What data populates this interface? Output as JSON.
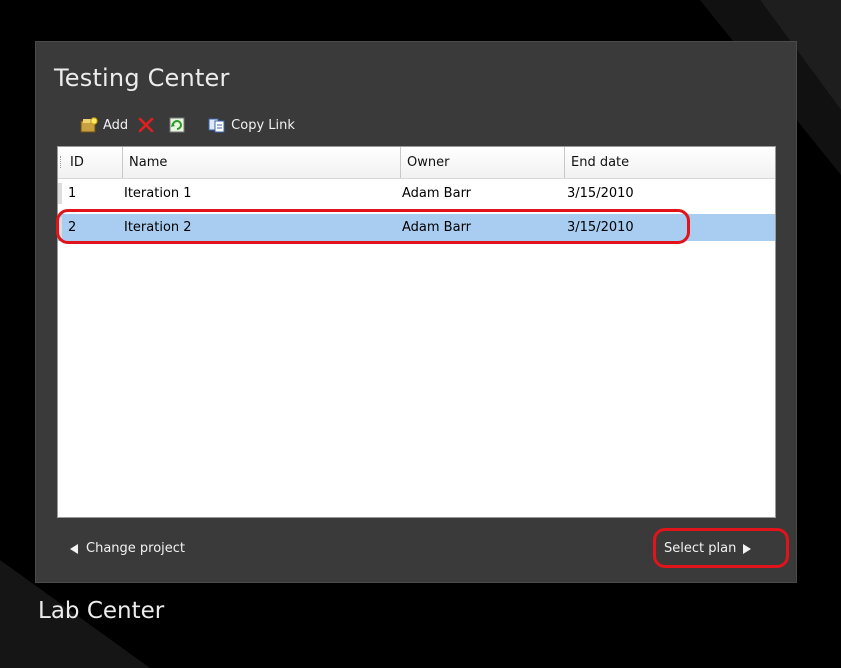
{
  "panel": {
    "title": "Testing Center"
  },
  "toolbar": {
    "add_label": "Add",
    "copy_link_label": "Copy Link"
  },
  "grid": {
    "columns": [
      "ID",
      "Name",
      "Owner",
      "End date"
    ],
    "rows": [
      {
        "id": "1",
        "name": "Iteration 1",
        "owner": "Adam Barr",
        "end_date": "3/15/2010",
        "selected": false
      },
      {
        "id": "2",
        "name": "Iteration 2",
        "owner": "Adam Barr",
        "end_date": "3/15/2010",
        "selected": true
      }
    ]
  },
  "footer": {
    "change_project_label": "Change project",
    "select_plan_label": "Select plan"
  },
  "lab_center": {
    "title": "Lab Center"
  },
  "colors": {
    "selection": "#a9cdf0",
    "highlight_ring": "#e0141a",
    "panel_bg": "#3a3a3a"
  },
  "icons": {
    "add": "add-plan-icon",
    "delete": "delete-x-icon",
    "refresh": "refresh-icon",
    "copy_link": "copy-link-icon",
    "back": "triangle-left-icon",
    "forward": "triangle-right-icon"
  }
}
